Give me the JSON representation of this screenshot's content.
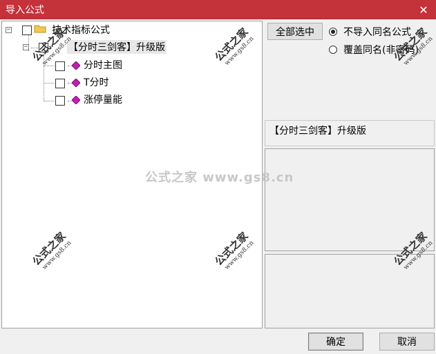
{
  "window": {
    "title": "导入公式",
    "close_glyph": "✕"
  },
  "tree": {
    "root": {
      "label": "技术指标公式",
      "expander": "−"
    },
    "formula": {
      "label": "【分时三剑客】升级版",
      "expander": "−"
    },
    "children": [
      {
        "label": "分时主图"
      },
      {
        "label": "T分时"
      },
      {
        "label": "涨停量能"
      }
    ]
  },
  "controls": {
    "select_all_label": "全部选中",
    "options": [
      {
        "label": "不导入同名公式",
        "selected": true
      },
      {
        "label": "覆盖同名(非密码)",
        "selected": false
      }
    ]
  },
  "info": {
    "selected_formula": "【分时三剑客】升级版"
  },
  "footer": {
    "ok_label": "确定",
    "cancel_label": "取消"
  },
  "watermark": {
    "center": "公式之家 www.gs8.cn",
    "stamp": "公式之家",
    "url": "www.gs8.cn"
  },
  "colors": {
    "titlebar": "#c4323a",
    "folder": "#f2c94c",
    "gem": "#c21fb0"
  }
}
